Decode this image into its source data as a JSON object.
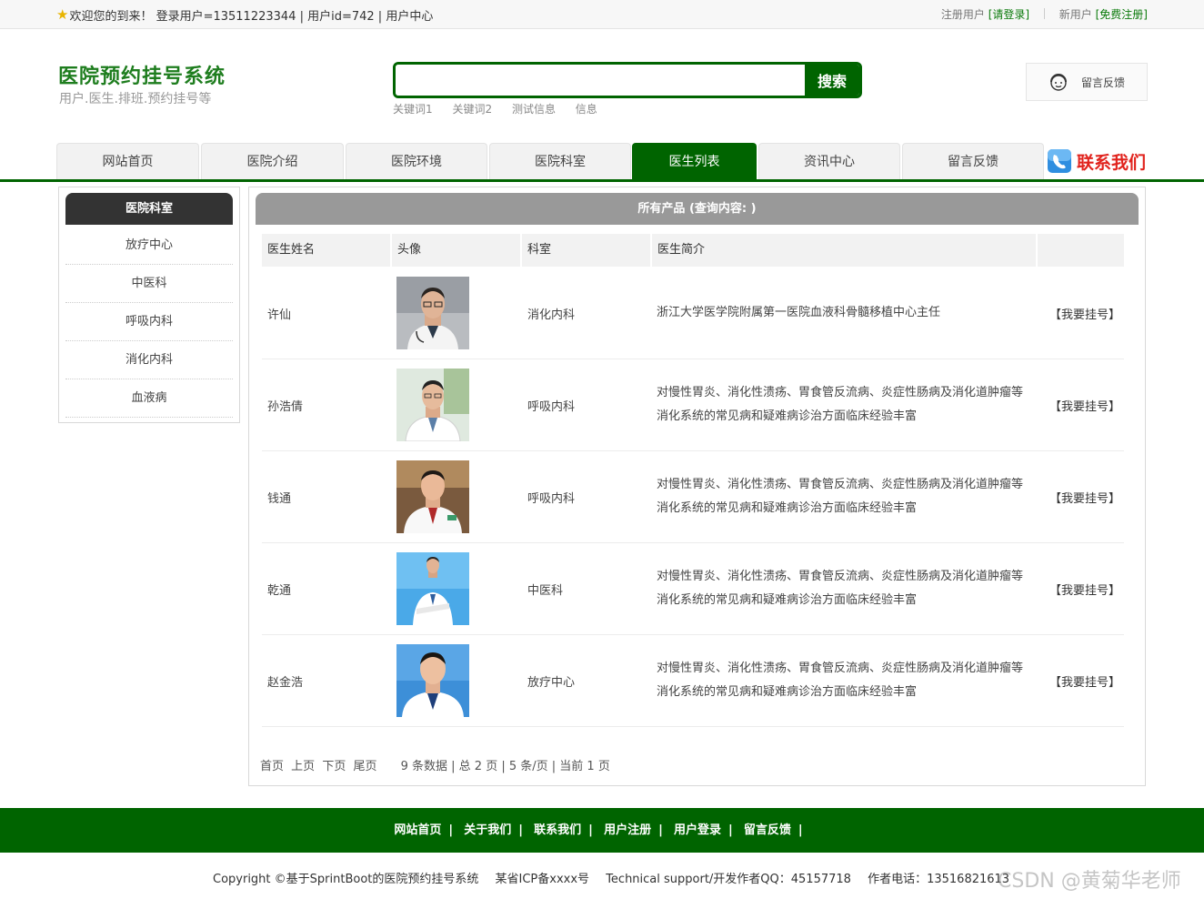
{
  "topbar": {
    "welcome": "欢迎您的到来！ 登录用户=13511223344 | 用户id=742 | 用户中心",
    "register_prefix": "注册用户",
    "login_link": "[请登录]",
    "new_user_prefix": "新用户",
    "register_link": "[免费注册]"
  },
  "header": {
    "title": "医院预约挂号系统",
    "subtitle": "用户.医生.排班.预约挂号等",
    "search_value": "",
    "search_button": "搜索",
    "keywords": [
      "关键词1",
      "关键词2",
      "测试信息",
      "信息"
    ],
    "feedback": "留言反馈"
  },
  "nav": {
    "tabs": [
      "网站首页",
      "医院介绍",
      "医院环境",
      "医院科室",
      "医生列表",
      "资讯中心",
      "留言反馈"
    ],
    "active": "医生列表",
    "contact": "联系我们"
  },
  "sidebar": {
    "title": "医院科室",
    "items": [
      "放疗中心",
      "中医科",
      "呼吸内科",
      "消化内科",
      "血液病"
    ]
  },
  "main": {
    "title": "所有产品 (查询内容: )",
    "columns": [
      "医生姓名",
      "头像",
      "科室",
      "医生简介",
      ""
    ],
    "rows": [
      {
        "name": "许仙",
        "dept": "消化内科",
        "intro": "浙江大学医学院附属第一医院血液科骨髓移植中心主任",
        "action": "【我要挂号】"
      },
      {
        "name": "孙浩倩",
        "dept": "呼吸内科",
        "intro": "对慢性胃炎、消化性溃疡、胃食管反流病、炎症性肠病及消化道肿瘤等消化系统的常见病和疑难病诊治方面临床经验丰富",
        "action": "【我要挂号】"
      },
      {
        "name": "钱通",
        "dept": "呼吸内科",
        "intro": "对慢性胃炎、消化性溃疡、胃食管反流病、炎症性肠病及消化道肿瘤等消化系统的常见病和疑难病诊治方面临床经验丰富",
        "action": "【我要挂号】"
      },
      {
        "name": "乾通",
        "dept": "中医科",
        "intro": "对慢性胃炎、消化性溃疡、胃食管反流病、炎症性肠病及消化道肿瘤等消化系统的常见病和疑难病诊治方面临床经验丰富",
        "action": "【我要挂号】"
      },
      {
        "name": "赵金浩",
        "dept": "放疗中心",
        "intro": "对慢性胃炎、消化性溃疡、胃食管反流病、炎症性肠病及消化道肿瘤等消化系统的常见病和疑难病诊治方面临床经验丰富",
        "action": "【我要挂号】"
      }
    ],
    "pager": {
      "first": "首页",
      "prev": "上页",
      "next": "下页",
      "last": "尾页",
      "info": "9 条数据 | 总 2 页 | 5 条/页 | 当前 1 页"
    }
  },
  "footer": {
    "links": [
      "网站首页",
      "关于我们",
      "联系我们",
      "用户注册",
      "用户登录",
      "留言反馈"
    ],
    "copyright": "Copyright ©基于SprintBoot的医院预约挂号系统",
    "icp": "某省ICP备xxxx号",
    "support": "Technical support/开发作者QQ：45157718",
    "phone": "作者电话：13516821613",
    "watermark": "CSDN @黄菊华老师"
  },
  "colors": {
    "brand_green": "#006400",
    "title_green": "#1e7d1e",
    "contact_red": "#e1231d"
  }
}
